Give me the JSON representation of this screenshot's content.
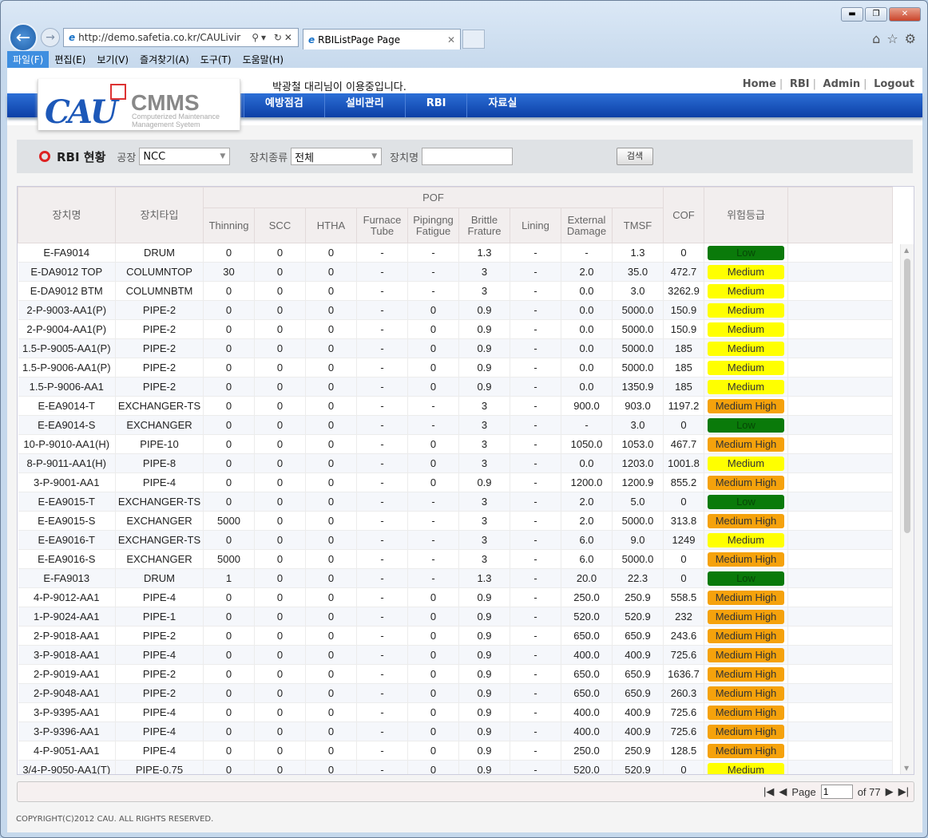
{
  "browser": {
    "url": "http://demo.safetia.co.kr/CAULivir",
    "tab_title": "RBIListPage Page",
    "menu": [
      "파일(F)",
      "편집(E)",
      "보기(V)",
      "즐겨찾기(A)",
      "도구(T)",
      "도움말(H)"
    ]
  },
  "header": {
    "logo_text": "CAU CMMS Computerized Maintenance Management Syetem",
    "user_text": "박광철 대리님이 이용중입니다.",
    "links": [
      "Home",
      "RBI",
      "Admin",
      "Logout"
    ],
    "nav": [
      "예방점검",
      "설비관리",
      "RBI",
      "자료실"
    ]
  },
  "search": {
    "title": "RBI 현황",
    "plant_label": "공장",
    "plant_value": "NCC",
    "type_label": "장치종류",
    "type_value": "전체",
    "name_label": "장치명",
    "name_value": "",
    "button": "검색"
  },
  "table": {
    "headers": {
      "name": "장치명",
      "type": "장치타입",
      "pof": "POF",
      "thinning": "Thinning",
      "scc": "SCC",
      "htha": "HTHA",
      "furnace": "Furnace Tube",
      "piping": "Pipingng Fatigue",
      "brittle": "Brittle Frature",
      "lining": "Lining",
      "external": "External Damage",
      "tmsf": "TMSF",
      "cof": "COF",
      "grade": "위험등급"
    },
    "grade_colors": {
      "Low": "#0a7a0a",
      "Medium": "#ffff00",
      "Medium High": "#f5a20c"
    },
    "rows": [
      [
        "E-FA9014",
        "DRUM",
        "0",
        "0",
        "0",
        "-",
        "-",
        "1.3",
        "-",
        "-",
        "1.3",
        "0",
        "Low"
      ],
      [
        "E-DA9012 TOP",
        "COLUMNTOP",
        "30",
        "0",
        "0",
        "-",
        "-",
        "3",
        "-",
        "2.0",
        "35.0",
        "472.7",
        "Medium"
      ],
      [
        "E-DA9012 BTM",
        "COLUMNBTM",
        "0",
        "0",
        "0",
        "-",
        "-",
        "3",
        "-",
        "0.0",
        "3.0",
        "3262.9",
        "Medium"
      ],
      [
        "2-P-9003-AA1(P)",
        "PIPE-2",
        "0",
        "0",
        "0",
        "-",
        "0",
        "0.9",
        "-",
        "0.0",
        "5000.0",
        "150.9",
        "Medium"
      ],
      [
        "2-P-9004-AA1(P)",
        "PIPE-2",
        "0",
        "0",
        "0",
        "-",
        "0",
        "0.9",
        "-",
        "0.0",
        "5000.0",
        "150.9",
        "Medium"
      ],
      [
        "1.5-P-9005-AA1(P)",
        "PIPE-2",
        "0",
        "0",
        "0",
        "-",
        "0",
        "0.9",
        "-",
        "0.0",
        "5000.0",
        "185",
        "Medium"
      ],
      [
        "1.5-P-9006-AA1(P)",
        "PIPE-2",
        "0",
        "0",
        "0",
        "-",
        "0",
        "0.9",
        "-",
        "0.0",
        "5000.0",
        "185",
        "Medium"
      ],
      [
        "1.5-P-9006-AA1",
        "PIPE-2",
        "0",
        "0",
        "0",
        "-",
        "0",
        "0.9",
        "-",
        "0.0",
        "1350.9",
        "185",
        "Medium"
      ],
      [
        "E-EA9014-T",
        "EXCHANGER-TS",
        "0",
        "0",
        "0",
        "-",
        "-",
        "3",
        "-",
        "900.0",
        "903.0",
        "1197.2",
        "Medium High"
      ],
      [
        "E-EA9014-S",
        "EXCHANGER",
        "0",
        "0",
        "0",
        "-",
        "-",
        "3",
        "-",
        "-",
        "3.0",
        "0",
        "Low"
      ],
      [
        "10-P-9010-AA1(H)",
        "PIPE-10",
        "0",
        "0",
        "0",
        "-",
        "0",
        "3",
        "-",
        "1050.0",
        "1053.0",
        "467.7",
        "Medium High"
      ],
      [
        "8-P-9011-AA1(H)",
        "PIPE-8",
        "0",
        "0",
        "0",
        "-",
        "0",
        "3",
        "-",
        "0.0",
        "1203.0",
        "1001.8",
        "Medium"
      ],
      [
        "3-P-9001-AA1",
        "PIPE-4",
        "0",
        "0",
        "0",
        "-",
        "0",
        "0.9",
        "-",
        "1200.0",
        "1200.9",
        "855.2",
        "Medium High"
      ],
      [
        "E-EA9015-T",
        "EXCHANGER-TS",
        "0",
        "0",
        "0",
        "-",
        "-",
        "3",
        "-",
        "2.0",
        "5.0",
        "0",
        "Low"
      ],
      [
        "E-EA9015-S",
        "EXCHANGER",
        "5000",
        "0",
        "0",
        "-",
        "-",
        "3",
        "-",
        "2.0",
        "5000.0",
        "313.8",
        "Medium High"
      ],
      [
        "E-EA9016-T",
        "EXCHANGER-TS",
        "0",
        "0",
        "0",
        "-",
        "-",
        "3",
        "-",
        "6.0",
        "9.0",
        "1249",
        "Medium"
      ],
      [
        "E-EA9016-S",
        "EXCHANGER",
        "5000",
        "0",
        "0",
        "-",
        "-",
        "3",
        "-",
        "6.0",
        "5000.0",
        "0",
        "Medium High"
      ],
      [
        "E-FA9013",
        "DRUM",
        "1",
        "0",
        "0",
        "-",
        "-",
        "1.3",
        "-",
        "20.0",
        "22.3",
        "0",
        "Low"
      ],
      [
        "4-P-9012-AA1",
        "PIPE-4",
        "0",
        "0",
        "0",
        "-",
        "0",
        "0.9",
        "-",
        "250.0",
        "250.9",
        "558.5",
        "Medium High"
      ],
      [
        "1-P-9024-AA1",
        "PIPE-1",
        "0",
        "0",
        "0",
        "-",
        "0",
        "0.9",
        "-",
        "520.0",
        "520.9",
        "232",
        "Medium High"
      ],
      [
        "2-P-9018-AA1",
        "PIPE-2",
        "0",
        "0",
        "0",
        "-",
        "0",
        "0.9",
        "-",
        "650.0",
        "650.9",
        "243.6",
        "Medium High"
      ],
      [
        "3-P-9018-AA1",
        "PIPE-4",
        "0",
        "0",
        "0",
        "-",
        "0",
        "0.9",
        "-",
        "400.0",
        "400.9",
        "725.6",
        "Medium High"
      ],
      [
        "2-P-9019-AA1",
        "PIPE-2",
        "0",
        "0",
        "0",
        "-",
        "0",
        "0.9",
        "-",
        "650.0",
        "650.9",
        "1636.7",
        "Medium High"
      ],
      [
        "2-P-9048-AA1",
        "PIPE-2",
        "0",
        "0",
        "0",
        "-",
        "0",
        "0.9",
        "-",
        "650.0",
        "650.9",
        "260.3",
        "Medium High"
      ],
      [
        "3-P-9395-AA1",
        "PIPE-4",
        "0",
        "0",
        "0",
        "-",
        "0",
        "0.9",
        "-",
        "400.0",
        "400.9",
        "725.6",
        "Medium High"
      ],
      [
        "3-P-9396-AA1",
        "PIPE-4",
        "0",
        "0",
        "0",
        "-",
        "0",
        "0.9",
        "-",
        "400.0",
        "400.9",
        "725.6",
        "Medium High"
      ],
      [
        "4-P-9051-AA1",
        "PIPE-4",
        "0",
        "0",
        "0",
        "-",
        "0",
        "0.9",
        "-",
        "250.0",
        "250.9",
        "128.5",
        "Medium High"
      ],
      [
        "3/4-P-9050-AA1(T)",
        "PIPE-0.75",
        "0",
        "0",
        "0",
        "-",
        "0",
        "0.9",
        "-",
        "520.0",
        "520.9",
        "0",
        "Medium"
      ]
    ]
  },
  "pager": {
    "page_label": "Page",
    "page_value": "1",
    "of_label": "of 77"
  },
  "footer": {
    "copyright": "COPYRIGHT(C)2012 CAU. ALL RIGHTS RESERVED."
  }
}
